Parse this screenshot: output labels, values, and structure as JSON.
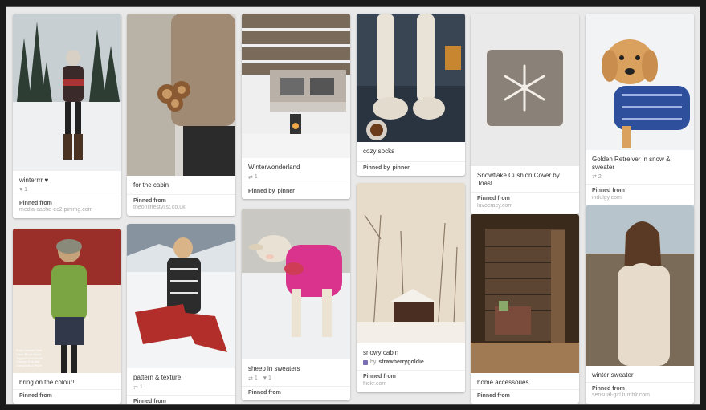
{
  "pins": [
    {
      "desc": "winterrrr ♥",
      "likes": "1",
      "pinned_label": "Pinned from",
      "source": "media-cache-ec2.pinimg.com"
    },
    {
      "desc": "for the cabin",
      "pinned_label": "Pinned from",
      "source": "theonlinestylist.co.uk"
    },
    {
      "desc": "Winterwonderland",
      "repins": "1",
      "pinned_by_label": "Pinned by",
      "pinner": "pinner"
    },
    {
      "desc": "cozy socks",
      "pinned_by_label": "Pinned by",
      "pinner": "pinner"
    },
    {
      "desc": "Snowflake Cushion Cover by Toast",
      "pinned_label": "Pinned from",
      "source": "luvocracy.com"
    },
    {
      "desc": "Golden Retreiver in snow & sweater",
      "repins": "2",
      "pinned_label": "Pinned from",
      "source": "indulgy.com"
    },
    {
      "desc": "bring on the colour!",
      "pinned_label": "Pinned from"
    },
    {
      "desc": "pattern & texture",
      "repins": "1",
      "pinned_label": "Pinned from"
    },
    {
      "desc": "sheep in sweaters",
      "repins": "1",
      "likes": "1",
      "pinned_label": "Pinned from"
    },
    {
      "desc": "snowy cabin",
      "by_label": "by",
      "author": "strawberrygoldie",
      "pinned_label": "Pinned from",
      "source": "flickr.com"
    },
    {
      "desc": "home accessories",
      "pinned_label": "Pinned from"
    },
    {
      "desc": "winter sweater",
      "pinned_label": "Pinned from",
      "source": "sensual-girl.tumblr.com"
    }
  ],
  "cover_text": "Posh Garden Tote\nColor Block Wool\nTopped Knit Bootie\nColorful Fair Isle\nCandyWear Proof"
}
